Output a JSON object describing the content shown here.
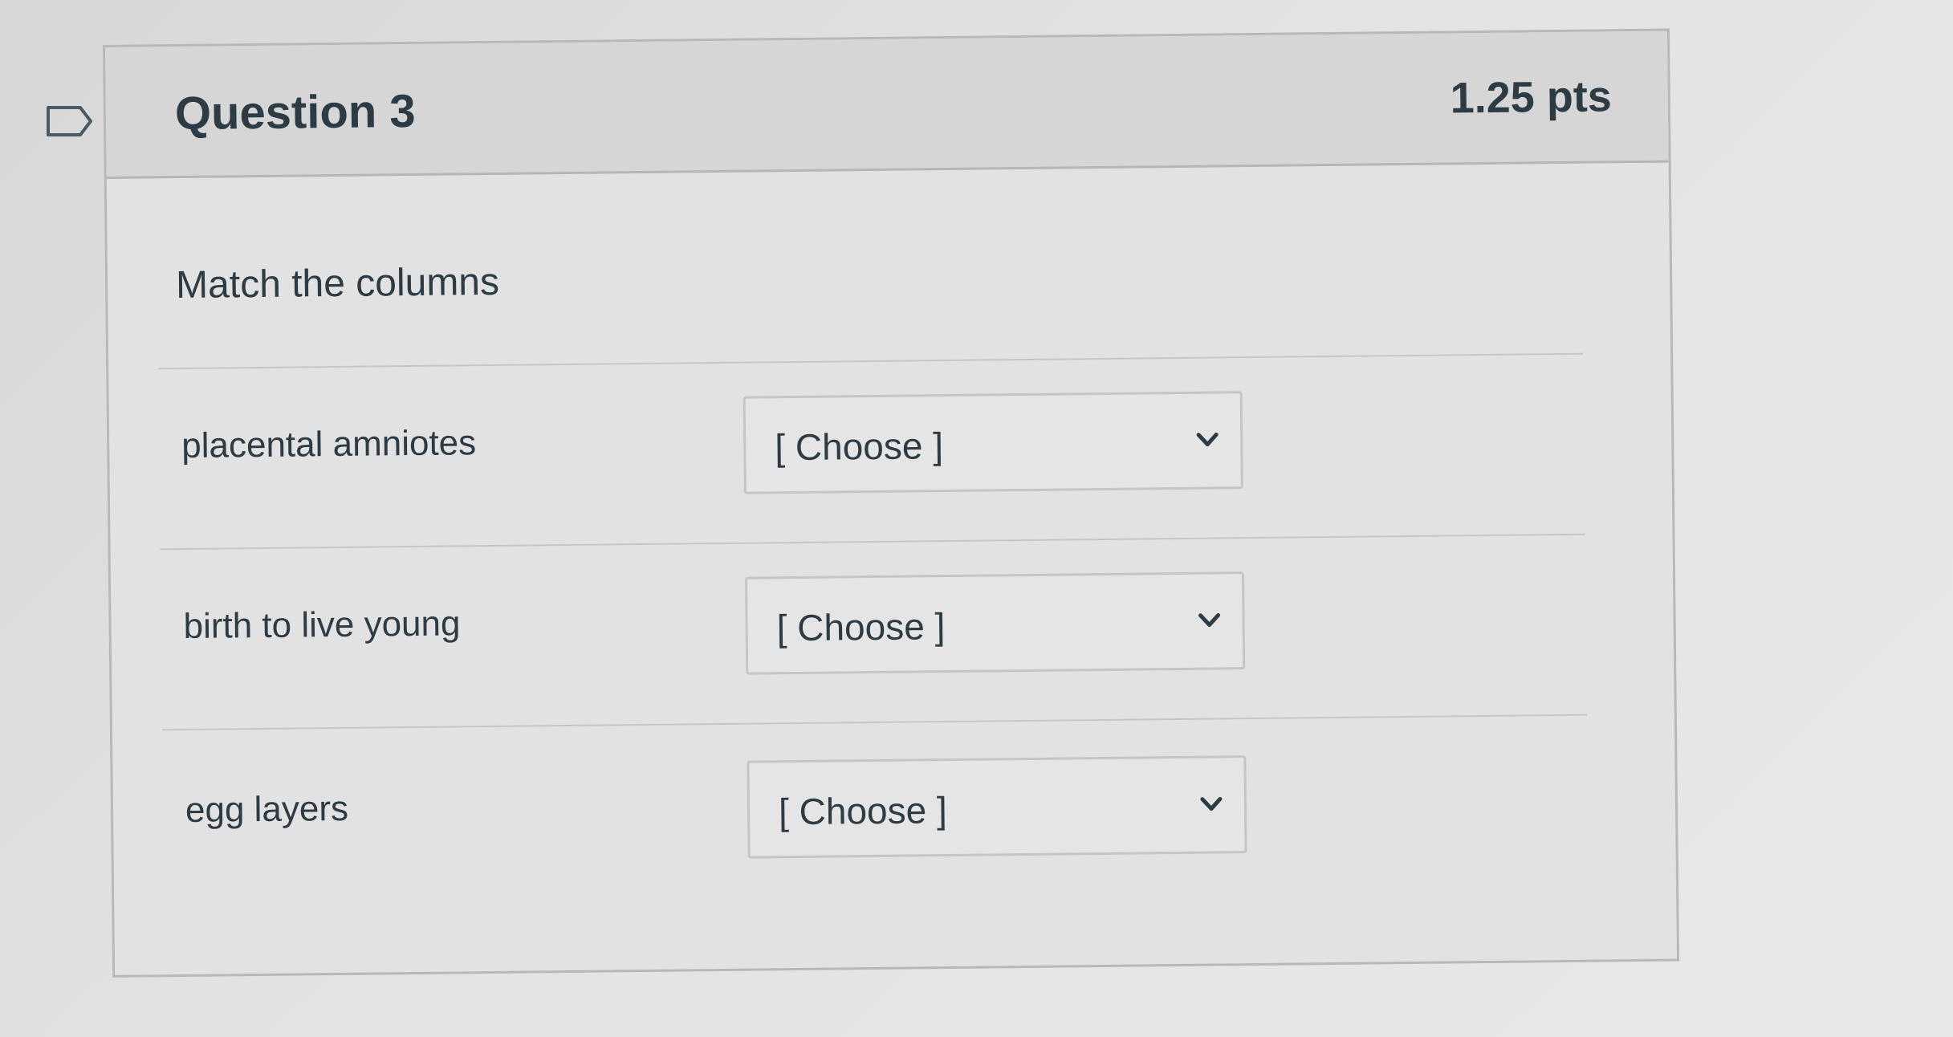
{
  "question": {
    "title": "Question 3",
    "points": "1.25 pts",
    "instructions": "Match the columns"
  },
  "matches": [
    {
      "label": "placental amniotes",
      "selected": "[ Choose ]"
    },
    {
      "label": "birth to live young",
      "selected": "[ Choose ]"
    },
    {
      "label": "egg layers",
      "selected": "[ Choose ]"
    }
  ],
  "icons": {
    "flag": "flag-outline-icon",
    "dropdown": "chevron-down-icon"
  },
  "colors": {
    "text": "#2d3b45",
    "header_bg": "#d6d6d6",
    "border": "#b8b8b8"
  }
}
